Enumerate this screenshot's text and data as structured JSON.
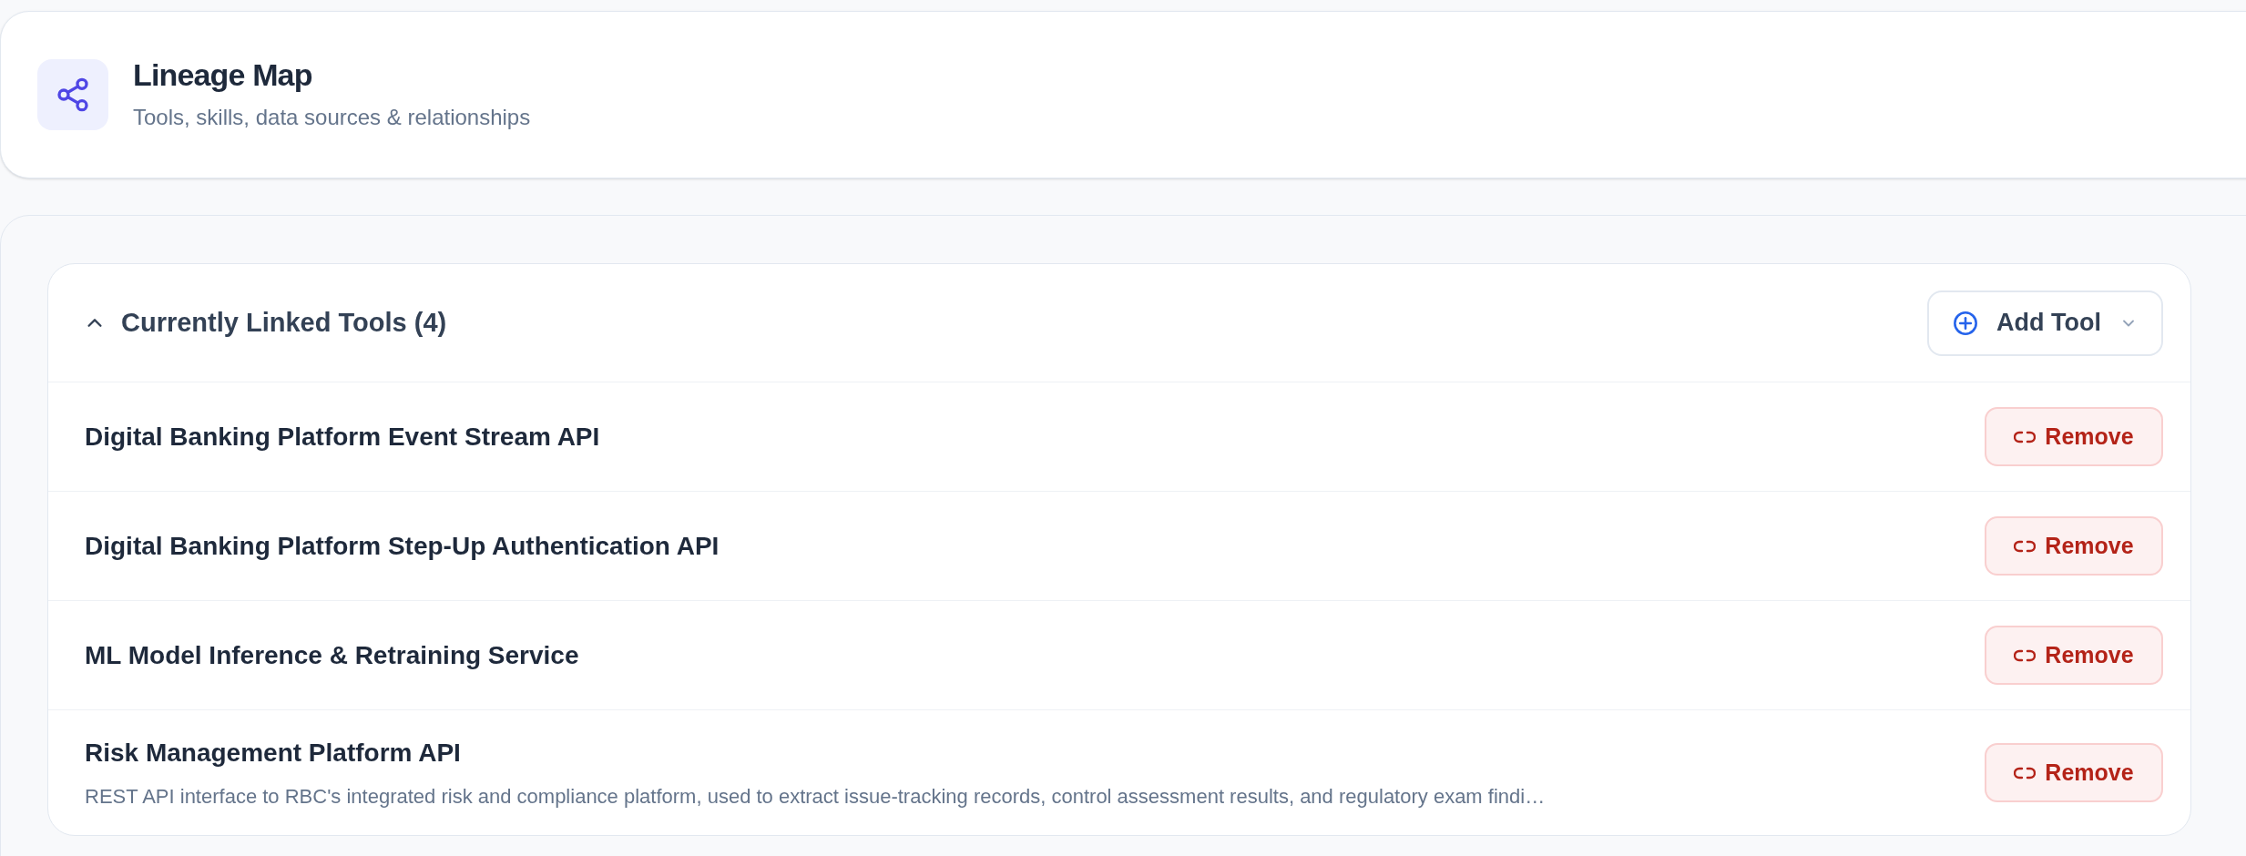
{
  "header": {
    "title": "Lineage Map",
    "subtitle": "Tools, skills, data sources & relationships"
  },
  "linked_tools": {
    "title": "Currently Linked Tools (4)",
    "expanded": true,
    "add_button": "Add Tool",
    "tools": [
      {
        "name": "Digital Banking Platform Event Stream API",
        "remove_button": "Remove"
      },
      {
        "name": "Digital Banking Platform Step-Up Authentication API",
        "remove_button": "Remove"
      },
      {
        "name": "ML Model Inference & Retraining Service",
        "remove_button": "Remove"
      },
      {
        "name": "Risk Management Platform API",
        "description": "REST API interface to RBC's integrated risk and compliance platform, used to extract issue-tracking records, control assessment results, and regulatory exam findi…",
        "remove_button": "Remove"
      }
    ]
  }
}
